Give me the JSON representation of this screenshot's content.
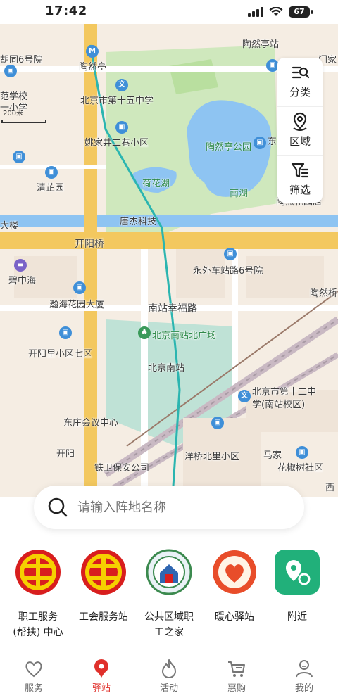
{
  "status_bar": {
    "time": "17:42",
    "battery": "67"
  },
  "map": {
    "scale_label": "200米",
    "labels": {
      "hutong6": "胡同6号院",
      "taoranting_station": "陶然亭",
      "taoranting_top": "陶然亭站",
      "fanxuexiao": "范学校",
      "yixiaoxue": "一小学",
      "no15_school": "北京市第十五中学",
      "yaojiajing": "姚家井二巷小区",
      "taoranting_park": "陶然亭公园",
      "heihuahu": "荷花湖",
      "nanhu": "南湖",
      "qingzhiyuan": "清芷园",
      "tangjie": "唐杰科技",
      "dalou": "大楼",
      "kaiyangqiao": "开阳桥",
      "yongwai": "永外车站路6号院",
      "bizhonghai": "碧中海",
      "hanhai": "瀚海花园大厦",
      "nanzhanxingfu": "南站幸福路",
      "taoranqiao": "陶然桥",
      "beijingnan_square": "北京南站北广场",
      "beijingnan": "北京南站",
      "kaiyangli": "开阳里小区七区",
      "no12_school_1": "北京市第十二中",
      "no12_school_2": "学(南站校区)",
      "dongzhuang": "东庄会议中心",
      "yangqiao": "洋桥北里小区",
      "huajiaoshu": "花椒树社区",
      "tielu": "铁卫保安公司",
      "kaiyang_road": "开阳",
      "majia": "马家",
      "dong": "东",
      "xi": "西",
      "men": "门家",
      "huacheng": "陶然花园店"
    }
  },
  "tools": [
    {
      "icon": "category-icon",
      "label": "分类"
    },
    {
      "icon": "region-icon",
      "label": "区域"
    },
    {
      "icon": "filter-icon",
      "label": "筛选"
    }
  ],
  "search": {
    "placeholder": "请输入阵地名称"
  },
  "quick_entries": [
    {
      "label_1": "职工服务",
      "label_2": "(帮扶) 中心"
    },
    {
      "label_1": "工会服务站"
    },
    {
      "label_1": "公共区域职",
      "label_2": "工之家"
    },
    {
      "label_1": "暖心驿站"
    },
    {
      "label_1": "附近"
    }
  ],
  "tabs": [
    {
      "label": "服务"
    },
    {
      "label": "驿站",
      "active": true
    },
    {
      "label": "活动"
    },
    {
      "label": "惠购"
    },
    {
      "label": "我的"
    }
  ],
  "colors": {
    "accent": "#e0302b",
    "union_red": "#d81e1e",
    "union_yellow": "#f6d000",
    "nearby_green": "#21b07a"
  }
}
